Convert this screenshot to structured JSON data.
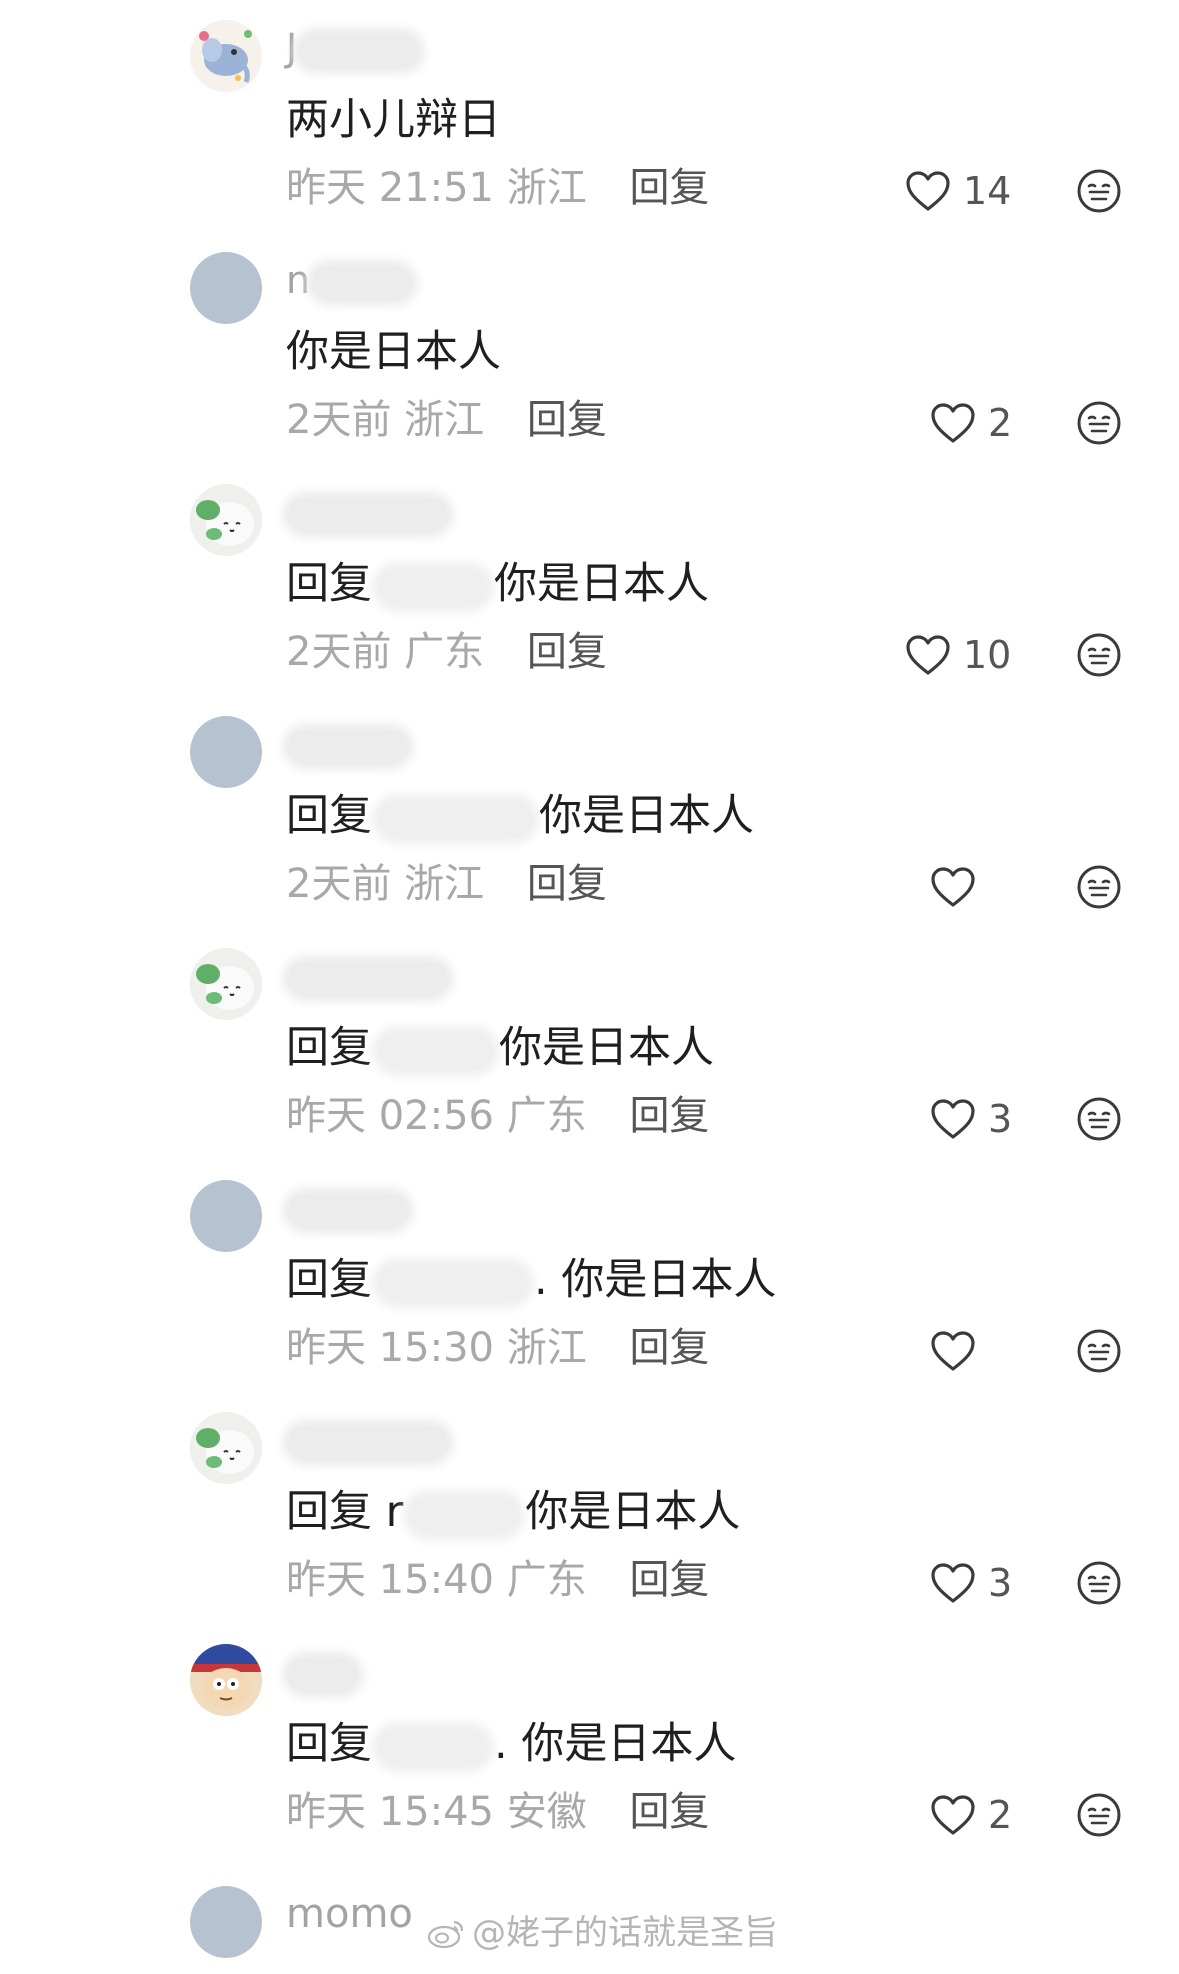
{
  "comments": [
    {
      "avatar": "avatar-elephant",
      "username_visible": "J",
      "content_prefix": "",
      "content_text": "两小儿辩日",
      "time": "昨天 21:51",
      "location": "浙江",
      "reply_label": "回复",
      "likes": "14"
    },
    {
      "avatar": "avatar-default",
      "username_visible": "n",
      "content_prefix": "",
      "content_text": "你是日本人",
      "time": "2天前",
      "location": "浙江",
      "reply_label": "回复",
      "likes": "2"
    },
    {
      "avatar": "avatar-plush",
      "username_visible": "",
      "content_prefix": "回复",
      "content_text": "你是日本人",
      "time": "2天前",
      "location": "广东",
      "reply_label": "回复",
      "likes": "10"
    },
    {
      "avatar": "avatar-default",
      "username_visible": "",
      "content_prefix": "回复",
      "content_text": "你是日本人",
      "time": "2天前",
      "location": "浙江",
      "reply_label": "回复",
      "likes": ""
    },
    {
      "avatar": "avatar-plush",
      "username_visible": "",
      "content_prefix": "回复",
      "content_text": "你是日本人",
      "time": "昨天 02:56",
      "location": "广东",
      "reply_label": "回复",
      "likes": "3"
    },
    {
      "avatar": "avatar-default",
      "username_visible": "",
      "content_prefix": "回复",
      "content_text": ". 你是日本人",
      "time": "昨天 15:30",
      "location": "浙江",
      "reply_label": "回复",
      "likes": ""
    },
    {
      "avatar": "avatar-plush",
      "username_visible": "",
      "content_prefix": "回复 r",
      "content_text": "你是日本人",
      "time": "昨天 15:40",
      "location": "广东",
      "reply_label": "回复",
      "likes": "3"
    },
    {
      "avatar": "avatar-cartoon",
      "username_visible": "",
      "content_prefix": "回复",
      "content_text": ". 你是日本人",
      "time": "昨天 15:45",
      "location": "安徽",
      "reply_label": "回复",
      "likes": "2"
    }
  ],
  "last_comment": {
    "username": "momo"
  },
  "watermark": "@姥子的话就是圣旨",
  "colors": {
    "text_primary": "#1f1f1f",
    "text_meta": "#a8a8a8",
    "reply_link": "#555555",
    "icon_stroke": "#3a3a3a",
    "default_avatar": "#b6c2cf"
  }
}
